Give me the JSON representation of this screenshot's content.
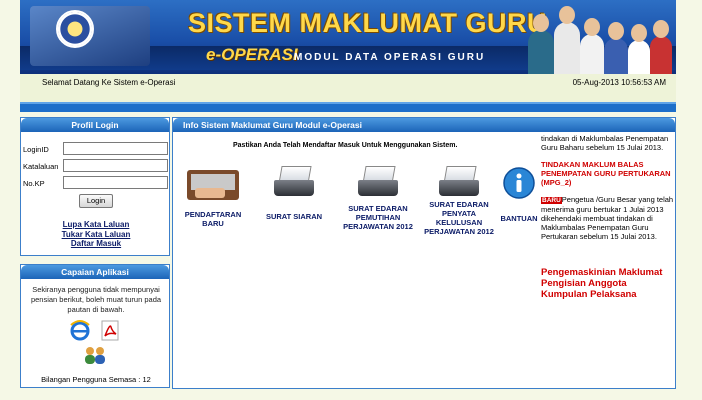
{
  "header": {
    "title": "SISTEM MAKLUMAT GURU",
    "subtitle": "e-OPERASI",
    "tagline": "MODUL DATA OPERASI GURU"
  },
  "greeting": {
    "welcome": "Selamat Datang Ke Sistem e-Operasi",
    "datetime": "05-Aug-2013 10:56:53 AM"
  },
  "login_panel": {
    "title": "Profil Login",
    "fields": [
      {
        "label": "LoginID",
        "value": ""
      },
      {
        "label": "Katalaluan",
        "value": ""
      },
      {
        "label": "No.KP",
        "value": ""
      }
    ],
    "button": "Login",
    "links": [
      "Lupa Kata Laluan",
      "Tukar Kata Laluan",
      "Daftar Masuk"
    ]
  },
  "apps_panel": {
    "title": "Capaian Aplikasi",
    "description": "Sekiranya pengguna tidak mempunyai pensian berikut, boleh muat turun pada pautan di bawah.",
    "icons": [
      "internet-explorer-icon",
      "acrobat-icon",
      "users-icon"
    ],
    "online_users": "Bilangan Pengguna Semasa : 12"
  },
  "main_panel": {
    "title": "Info Sistem Maklumat Guru Modul e-Operasi",
    "notice": "Pastikan Anda Telah Mendaftar Masuk Untuk Menggunakan Sistem.",
    "tiles": [
      {
        "label": "PENDAFTARAN BARU",
        "icon": "keyboard-icon"
      },
      {
        "label": "SURAT SIARAN",
        "icon": "inbox-tray-icon"
      },
      {
        "label": "SURAT EDARAN PEMUTIHAN PERJAWATAN 2012",
        "icon": "inbox-tray-icon"
      },
      {
        "label": "SURAT EDARAN PENYATA KELULUSAN PERJAWATAN 2012",
        "icon": "inbox-tray-icon"
      },
      {
        "label": "BANTUAN",
        "icon": "info-icon"
      }
    ]
  },
  "announcements": {
    "text1": "tindakan di Maklumbalas Penempatan Guru Baharu sebelum 15 Julai 2013.",
    "heading2": "TINDAKAN MAKLUM BALAS PENEMPATAN GURU PERTUKARAN (MPG_2)",
    "badge": "BARU",
    "text2": "Pengetua /Guru Besar yang telah menerima guru bertukar 1 Julai 2013 dikehendaki membuat tindakan di Maklumbalas Penempatan Guru Pertukaran sebelum 15 Julai 2013.",
    "link": "Pengemaskinian Maklumat Pengisian Anggota Kumpulan Pelaksana"
  },
  "colors": {
    "banner": "#1a4fa8",
    "accent": "#1d6fc9",
    "alert": "#d00000",
    "link": "#0a1a66"
  }
}
